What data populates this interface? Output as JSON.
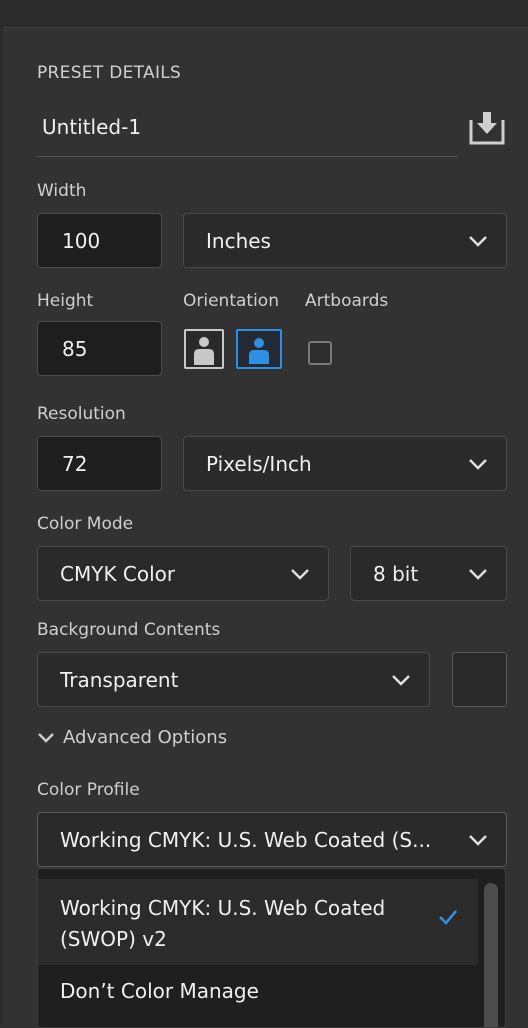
{
  "panel": {
    "section_title": "PRESET DETAILS",
    "preset_name": "Untitled-1"
  },
  "width": {
    "label": "Width",
    "value": "100",
    "unit": "Inches"
  },
  "height": {
    "label": "Height",
    "value": "85"
  },
  "orientation": {
    "label": "Orientation",
    "selected": "landscape"
  },
  "artboards": {
    "label": "Artboards",
    "checked": false
  },
  "resolution": {
    "label": "Resolution",
    "value": "72",
    "unit": "Pixels/Inch"
  },
  "color_mode": {
    "label": "Color Mode",
    "mode": "CMYK Color",
    "depth": "8 bit"
  },
  "background": {
    "label": "Background Contents",
    "value": "Transparent"
  },
  "advanced": {
    "label": "Advanced Options"
  },
  "color_profile": {
    "label": "Color Profile",
    "value": "Working CMYK: U.S. Web Coated (S...",
    "options": [
      {
        "line1": "Working CMYK: U.S. Web Coated",
        "line2": "(SWOP) v2",
        "checked": true
      },
      {
        "line1": "Don’t Color Manage"
      }
    ]
  },
  "colors": {
    "accent": "#2f8fe0",
    "panel_bg": "#323232"
  }
}
